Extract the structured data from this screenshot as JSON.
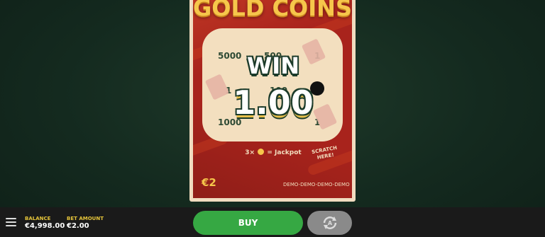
{
  "game": {
    "title": "GOLD COINS",
    "win_label": "WIN",
    "win_amount": "1.00",
    "jackpot_prefix": "3×",
    "jackpot_suffix": "= Jackpot",
    "scratch_hint_line1": "SCRATCH",
    "scratch_hint_line2": "HERE!",
    "ticket_price": "€2",
    "demo_text": "DEMO-DEMO-DEMO-DEMO",
    "cells": {
      "r1c1": "5000",
      "r1c2": "500",
      "r1c3": "1",
      "r2c1": "1",
      "r2c2": "100",
      "r3c1": "1000",
      "r3c3": "1"
    }
  },
  "bottom_bar": {
    "balance_label": "BALANCE",
    "balance_value": "€4,998.00",
    "bet_label": "BET AMOUNT",
    "bet_value": "€2.00",
    "buy_label": "BUY",
    "autoplay_icon": "autoplay-icon",
    "menu_icon": "menu-icon"
  },
  "colors": {
    "card_red": "#a8231c",
    "gold": "#f6c64b",
    "buy_green": "#36a843",
    "label_yellow": "#e5c43a"
  }
}
